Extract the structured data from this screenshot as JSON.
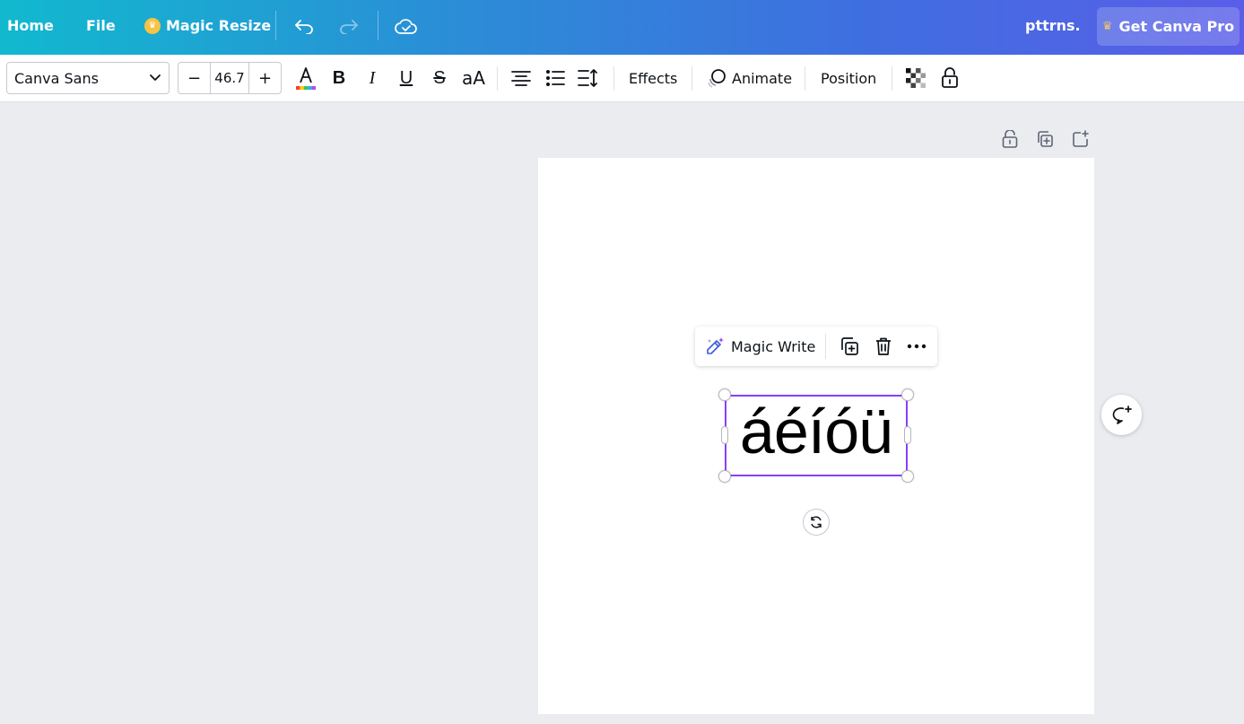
{
  "topbar": {
    "home": "Home",
    "file": "File",
    "magic_resize": "Magic Resize",
    "brand": "pttrns.",
    "get_pro": "Get Canva Pro"
  },
  "toolbar": {
    "font_name": "Canva Sans",
    "font_size": "46.7",
    "decrease": "−",
    "increase": "+",
    "case_label": "aA",
    "effects": "Effects",
    "animate": "Animate",
    "position": "Position"
  },
  "context_menu": {
    "magic_write": "Magic Write"
  },
  "canvas": {
    "text": "áéíóü"
  },
  "colors": {
    "selection": "#8b3dff",
    "gradient_start": "#11b9cf",
    "gradient_end": "#5a5ee8"
  }
}
